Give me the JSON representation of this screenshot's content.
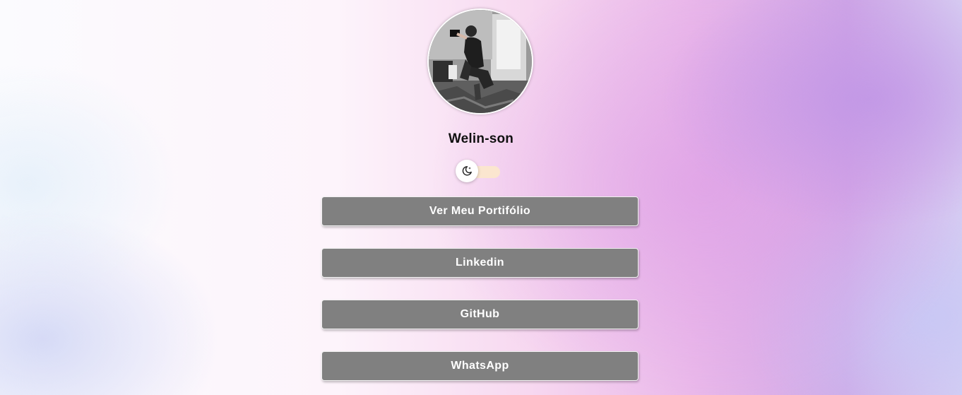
{
  "profile": {
    "name": "Welin-son",
    "avatar_icon": "profile-photo"
  },
  "theme_toggle": {
    "icon": "moon-icon",
    "knob_color": "#ffffff",
    "track_color": "#fbe6cf"
  },
  "links": [
    {
      "label": "Ver Meu Portifólio"
    },
    {
      "label": "Linkedin"
    },
    {
      "label": "GitHub"
    },
    {
      "label": "WhatsApp"
    }
  ],
  "colors": {
    "button_bg": "#808080",
    "button_text": "#ffffff",
    "name_text": "#111111"
  }
}
